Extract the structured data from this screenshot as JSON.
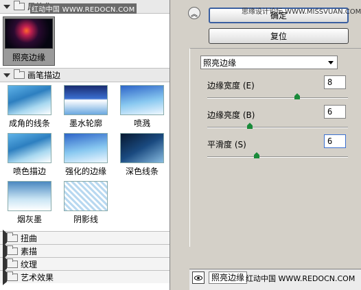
{
  "gallery": {
    "artistic_category": "风格化",
    "watermark_top": "红动中国 WWW.REDOCN.COM",
    "selected_filter": "照亮边缘",
    "brush_category": "画笔描边",
    "brush_filters": [
      "成角的线条",
      "墨水轮廓",
      "喷溅",
      "喷色描边",
      "强化的边缘",
      "深色线条",
      "烟灰墨",
      "阴影线"
    ],
    "collapsed_categories": [
      "扭曲",
      "素描",
      "纹理",
      "艺术效果"
    ]
  },
  "right_panel": {
    "ok_label": "确定",
    "reset_label": "复位",
    "watermark_mid": "思缘设计论坛 WWW.MISSVUAN.COM",
    "filter_select": "照亮边缘",
    "params": [
      {
        "label": "边缘宽度 (E)",
        "value": "8",
        "slider_fraction": 0.64
      },
      {
        "label": "边缘亮度 (B)",
        "value": "6",
        "slider_fraction": 0.3
      },
      {
        "label": "平滑度 (S)",
        "value": "6",
        "slider_fraction": 0.35
      }
    ],
    "layer_name": "照亮边缘",
    "watermark_bottom": "红动中国 WWW.REDOCN.COM"
  },
  "colors": {
    "panel_bg": "#d4d0c8",
    "slider_thumb": "#1a8a3a",
    "ok_border": "#3a5fa0"
  },
  "icons": [
    "triangle-down-icon",
    "triangle-right-icon",
    "folder-icon",
    "collapse-up-icon",
    "dropdown-arrow-icon",
    "eye-icon"
  ]
}
